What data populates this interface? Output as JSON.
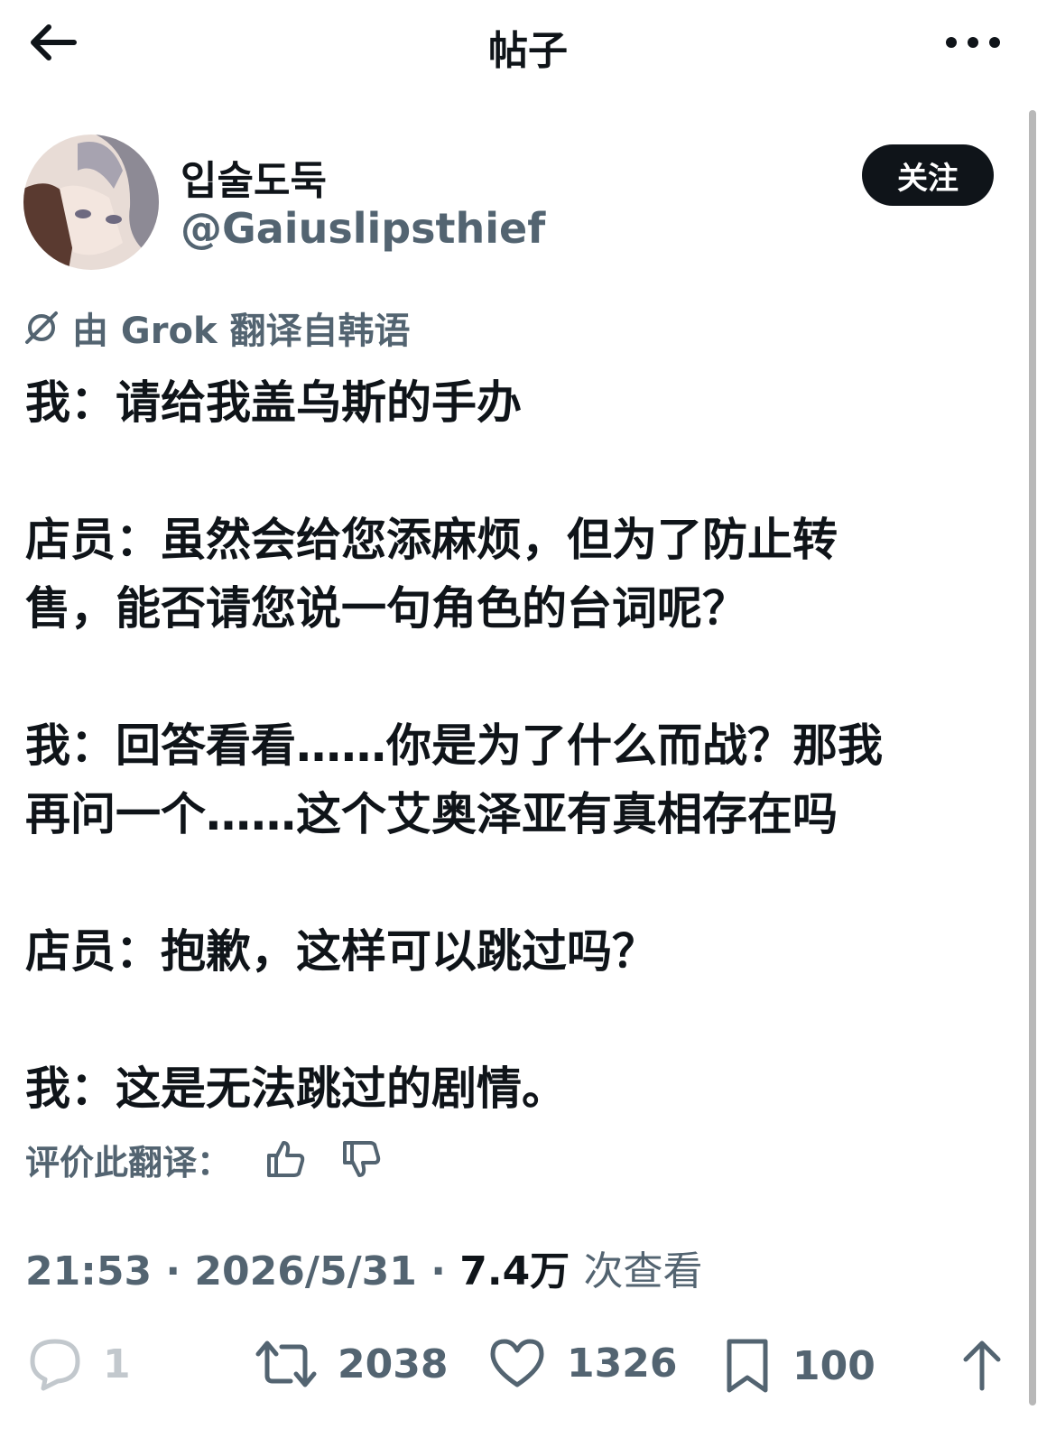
{
  "header": {
    "title": "帖子"
  },
  "author": {
    "display_name": "입술도둑",
    "handle": "@Gaiuslipsthief"
  },
  "follow_button": {
    "label": "关注"
  },
  "translation_note": "由 Grok 翻译自韩语",
  "paragraphs": [
    "我：请给我盖乌斯的手办",
    "店员：虽然会给您添麻烦，但为了防止转\n售，能否请您说一句角色的台词呢？",
    "我：回答看看……你是为了什么而战？那我\n再问一个……这个艾奥泽亚有真相存在吗",
    "店员：抱歉，这样可以跳过吗？",
    "我：这是无法跳过的剧情。"
  ],
  "rate_translation": {
    "label": "评价此翻译："
  },
  "meta": {
    "time": "21:53",
    "date": "2026/5/31",
    "views": "7.4万",
    "views_label": "次查看"
  },
  "actions": {
    "replies": "1",
    "reposts": "2038",
    "likes": "1326",
    "bookmarks": "100"
  },
  "icons": [
    "back-arrow-icon",
    "more-icon",
    "grok-icon",
    "thumbs-up-icon",
    "thumbs-down-icon",
    "reply-icon",
    "repost-icon",
    "like-icon",
    "bookmark-icon",
    "share-icon"
  ],
  "colors": {
    "text": "#0f1419",
    "muted": "#536471",
    "button_bg": "#0f1419"
  }
}
